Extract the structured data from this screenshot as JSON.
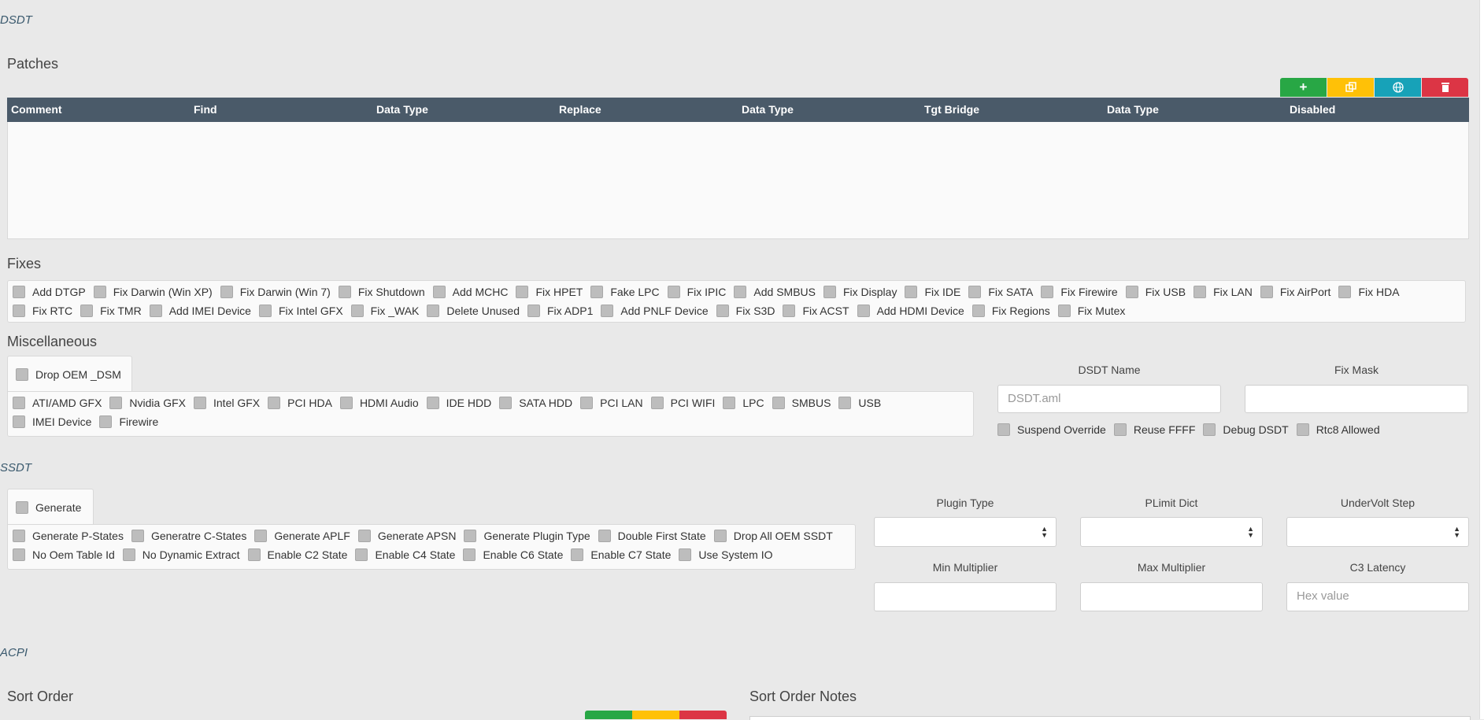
{
  "dsdt": {
    "tag": "DSDT",
    "patches": {
      "title": "Patches",
      "toolbar": {
        "add_icon": "plus-icon",
        "copy_icon": "copy-icon",
        "globe_icon": "globe-icon",
        "delete_icon": "trash-icon"
      },
      "columns": [
        "Comment",
        "Find",
        "Data Type",
        "Replace",
        "Data Type",
        "Tgt Bridge",
        "Data Type",
        "Disabled"
      ]
    },
    "fixes": {
      "title": "Fixes",
      "items": [
        "Add DTGP",
        "Fix Darwin (Win XP)",
        "Fix Darwin (Win 7)",
        "Fix Shutdown",
        "Add MCHC",
        "Fix HPET",
        "Fake LPC",
        "Fix IPIC",
        "Add SMBUS",
        "Fix Display",
        "Fix IDE",
        "Fix SATA",
        "Fix Firewire",
        "Fix USB",
        "Fix LAN",
        "Fix AirPort",
        "Fix HDA",
        "Fix RTC",
        "Fix TMR",
        "Add IMEI Device",
        "Fix Intel GFX",
        "Fix _WAK",
        "Delete Unused",
        "Fix ADP1",
        "Add PNLF Device",
        "Fix S3D",
        "Fix ACST",
        "Add HDMI Device",
        "Fix Regions",
        "Fix Mutex"
      ]
    },
    "misc": {
      "title": "Miscellaneous",
      "tab_label": "Drop OEM _DSM",
      "items": [
        "ATI/AMD GFX",
        "Nvidia GFX",
        "Intel GFX",
        "PCI HDA",
        "HDMI Audio",
        "IDE HDD",
        "SATA HDD",
        "PCI LAN",
        "PCI WIFI",
        "LPC",
        "SMBUS",
        "USB",
        "IMEI Device",
        "Firewire"
      ],
      "dsdt_name_label": "DSDT Name",
      "dsdt_name_placeholder": "DSDT.aml",
      "fix_mask_label": "Fix Mask",
      "fix_mask_value": "",
      "options": [
        "Suspend Override",
        "Reuse FFFF",
        "Debug DSDT",
        "Rtc8 Allowed"
      ]
    }
  },
  "ssdt": {
    "tag": "SSDT",
    "tab_label": "Generate",
    "items": [
      "Generate P-States",
      "Generatre C-States",
      "Generate APLF",
      "Generate APSN",
      "Generate Plugin Type",
      "Double First State",
      "Drop All OEM SSDT",
      "No Oem Table Id",
      "No Dynamic Extract",
      "Enable C2 State",
      "Enable C4 State",
      "Enable C6 State",
      "Enable C7 State",
      "Use System IO"
    ],
    "plugin_type_label": "Plugin Type",
    "plimit_dict_label": "PLimit Dict",
    "undervolt_step_label": "UnderVolt Step",
    "min_multiplier_label": "Min Multiplier",
    "max_multiplier_label": "Max Multiplier",
    "c3_latency_label": "C3 Latency",
    "c3_latency_placeholder": "Hex value"
  },
  "acpi": {
    "tag": "ACPI",
    "sort_order_title": "Sort Order",
    "sort_order_notes_title": "Sort Order Notes"
  },
  "colors": {
    "header": "#4a5a69",
    "green": "#28a745",
    "yellow": "#ffc107",
    "teal": "#17a2b8",
    "red": "#dc3545"
  }
}
